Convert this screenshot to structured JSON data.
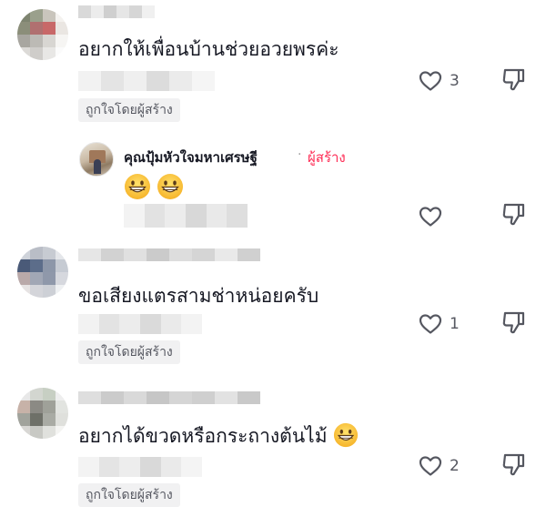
{
  "comments": [
    {
      "text": "อยากให้เพื่อนบ้านช่วยอวยพรค่ะ",
      "liked_badge": "ถูกใจโดยผู้สร้าง",
      "like_count": "3",
      "avatar_colors": [
        "#7e8470",
        "#9aa08c",
        "#c9c5bc",
        "#f4f2ef",
        "#8b8e7a",
        "#b07070",
        "#c86868",
        "#eae6e2",
        "#a8a6a0",
        "#bcbab5",
        "#d8d6d2",
        "#f6f5f3",
        "#dcdad7",
        "#cfcdca",
        "#e8e7e5",
        "#fbfbfb"
      ]
    },
    {
      "text": "ขอเสียงแตรสามช่าหน่อยครับ",
      "liked_badge": "ถูกใจโดยผู้สร้าง",
      "like_count": "1",
      "avatar_colors": [
        "#cfd3da",
        "#b9bdc6",
        "#c7cbd2",
        "#e4e6ea",
        "#4a5a78",
        "#5c6d8a",
        "#8d97a9",
        "#c6cbd3",
        "#b9a9a9",
        "#a1a7b5",
        "#8f98aa",
        "#d6d8de",
        "#e6e3e3",
        "#d4d5da",
        "#cdd0d6",
        "#eef0f2"
      ]
    },
    {
      "text": "อยากได้ขวดหรือกระถางต้นไม้",
      "liked_badge": "ถูกใจโดยผู้สร้าง",
      "like_count": "2",
      "avatar_colors": [
        "#e8e8e8",
        "#d3d6d0",
        "#c7cfc3",
        "#eeeeee",
        "#c7b2a8",
        "#8b8a84",
        "#9fa199",
        "#e2e4e0",
        "#a1a39c",
        "#6e7068",
        "#a9aba4",
        "#dfe0dc",
        "#d8d7d4",
        "#c8c9c4",
        "#e0e1dd",
        "#f4f4f2"
      ]
    }
  ],
  "reply": {
    "author": "คุณปุ้มหัวใจมหาเศรษฐี",
    "separator": "·",
    "creator_label": "ผู้สร้าง",
    "emoji": [
      "grinning-face",
      "grinning-face"
    ]
  },
  "colors": {
    "text": "#161823",
    "secondary": "#555760",
    "creator_pink": "#fe2c55",
    "badge_bg": "#f1f1f2"
  },
  "icons": {
    "like": "heart-outline-icon",
    "dislike": "thumbs-down-outline-icon"
  }
}
